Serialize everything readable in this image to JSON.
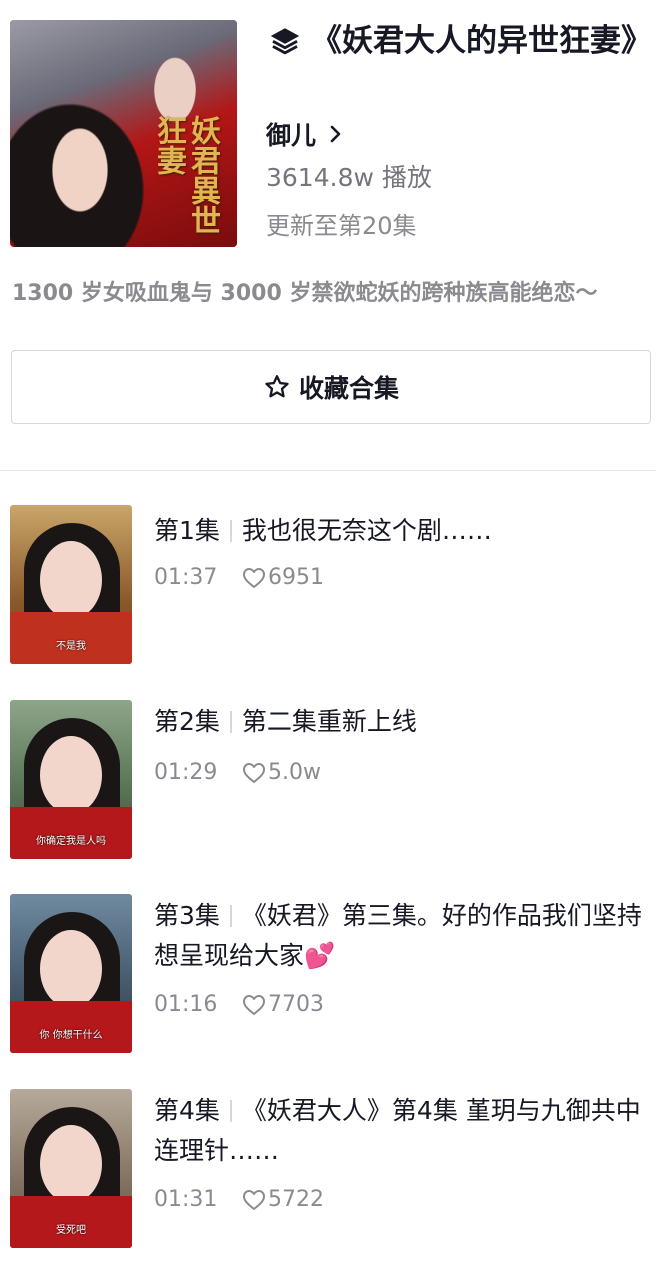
{
  "collection": {
    "icon": "layers-icon",
    "title": "《妖君大人的异世狂妻》",
    "author": "御儿",
    "play_count": "3614.8w 播放",
    "update_status": "更新至第20集",
    "description": "1300 岁女吸血鬼与 3000 岁禁欲蛇妖的跨种族高能绝恋～",
    "cover_art_text": "妖君異世狂妻"
  },
  "favorite_button": {
    "icon": "star-icon",
    "label": "收藏合集"
  },
  "episodes": [
    {
      "number": "第1集",
      "title": "我也很无奈这个剧……",
      "duration": "01:37",
      "likes": "6951",
      "thumb_caption": "不是我"
    },
    {
      "number": "第2集",
      "title": "第二集重新上线",
      "duration": "01:29",
      "likes": "5.0w",
      "thumb_caption": "你确定我是人吗"
    },
    {
      "number": "第3集",
      "title": "《妖君》第三集。好的作品我们坚持想呈现给大家💕",
      "duration": "01:16",
      "likes": "7703",
      "thumb_caption": "你 你想干什么"
    },
    {
      "number": "第4集",
      "title": "《妖君大人》第4集 堇玥与九御共中连理针……",
      "duration": "01:31",
      "likes": "5722",
      "thumb_caption": "受死吧"
    }
  ],
  "colors": {
    "primary_text": "#161823",
    "secondary_text": "#8a8b91",
    "border": "#d6d7da",
    "robe_red": "#b4181b"
  }
}
